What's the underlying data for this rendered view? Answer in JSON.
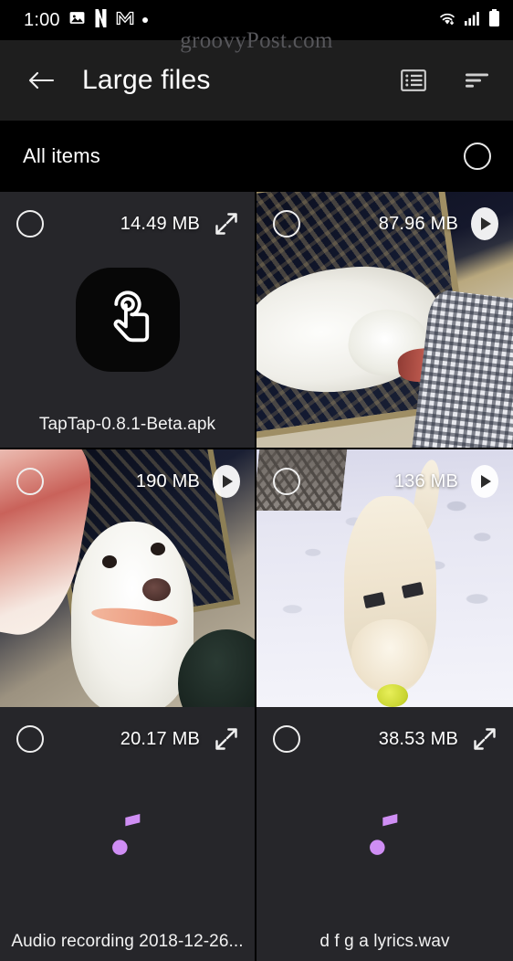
{
  "statusbar": {
    "time": "1:00",
    "left_icons": [
      "image-icon",
      "netflix-icon",
      "gmail-icon",
      "dot-icon"
    ],
    "right_icons": [
      "wifi-icon",
      "cellular-signal-icon",
      "battery-icon"
    ]
  },
  "watermark": {
    "text": "groovyPost.com"
  },
  "appbar": {
    "back_icon": "back-arrow-icon",
    "title": "Large files",
    "actions": [
      {
        "name": "list-view-icon",
        "label": "List view"
      },
      {
        "name": "sort-icon",
        "label": "Sort"
      }
    ]
  },
  "section": {
    "title": "All items",
    "select_all_icon": "circle-checkbox-icon"
  },
  "colors": {
    "statusbar_bg": "#000000",
    "appbar_bg": "#1e1e1e",
    "section_bg": "#000000",
    "tile_bg": "#26262a",
    "text_primary": "#ffffff",
    "watermark": "#56565a",
    "music_note": "#cf8ef4"
  },
  "files": [
    {
      "name": "TapTap-0.8.1-Beta.apk",
      "size": "14.49 MB",
      "type": "apk",
      "action_icon": "expand-icon",
      "checkbox_icon": "circle-checkbox-icon",
      "center_icon": "tap-gesture-icon"
    },
    {
      "name": "",
      "size": "87.96 MB",
      "type": "video",
      "action_icon": "play-icon",
      "checkbox_icon": "circle-checkbox-icon",
      "thumbnail": "white-dog-lying-on-ornate-rug-chewing-bone"
    },
    {
      "name": "",
      "size": "190 MB",
      "type": "video",
      "action_icon": "play-icon",
      "checkbox_icon": "circle-checkbox-icon",
      "thumbnail": "white-dog-looking-up-with-large-bone-in-foreground"
    },
    {
      "name": "",
      "size": "136 MB",
      "type": "video",
      "action_icon": "play-icon",
      "checkbox_icon": "circle-checkbox-icon",
      "thumbnail": "cream-dog-playing-in-snow-with-tennis-ball"
    },
    {
      "name": "Audio recording 2018-12-26...",
      "size": "20.17 MB",
      "type": "audio",
      "action_icon": "expand-icon",
      "checkbox_icon": "circle-checkbox-icon",
      "center_icon": "music-note-icon"
    },
    {
      "name": "d f g a lyrics.wav",
      "size": "38.53 MB",
      "type": "audio",
      "action_icon": "expand-icon",
      "checkbox_icon": "circle-checkbox-icon",
      "center_icon": "music-note-icon"
    }
  ]
}
